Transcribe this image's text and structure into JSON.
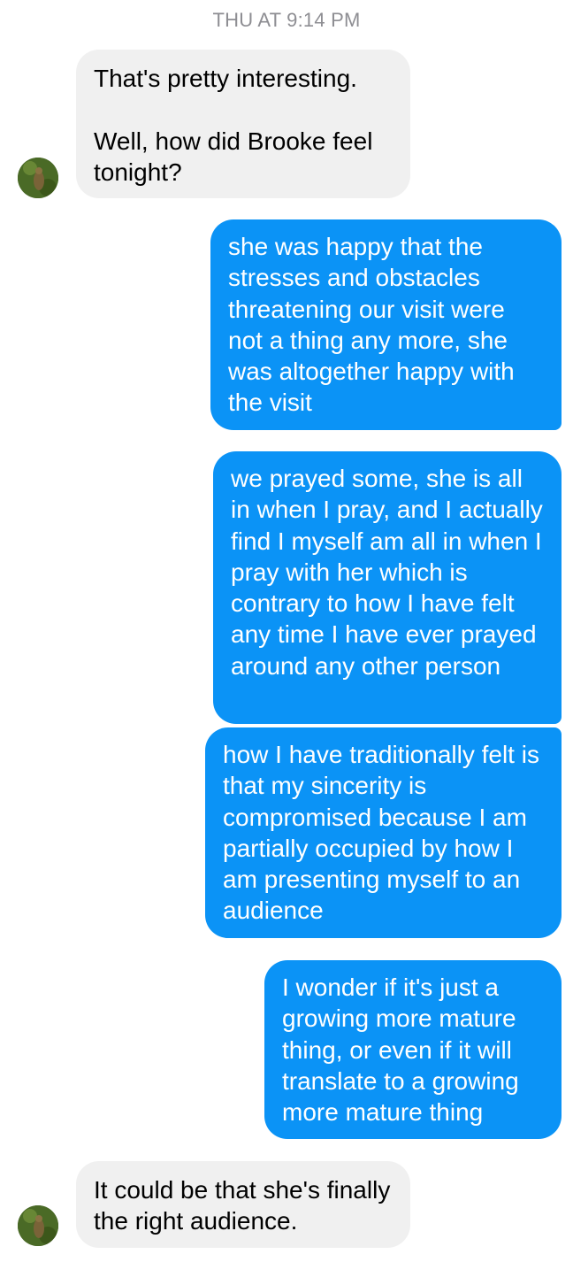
{
  "thread": {
    "timestamp": "THU AT 9:14 PM",
    "messages": [
      {
        "direction": "incoming",
        "text": "That's pretty interesting.\n\nWell, how did Brooke feel tonight?"
      },
      {
        "direction": "outgoing",
        "text": "she was happy that the stresses and obstacles threatening our visit were not a thing any more, she was altogether happy with the visit"
      },
      {
        "direction": "outgoing",
        "text": "we prayed some, she is all in when I pray, and I actually find I myself am all in when I pray with her which is contrary to how I have felt any time I have ever prayed around any other person"
      },
      {
        "direction": "outgoing",
        "text": "how I have traditionally felt is that my sincerity is compromised because I am partially occupied by how I am presenting myself to an audience"
      },
      {
        "direction": "outgoing",
        "text": "I wonder if it's just a growing more mature thing, or even if it will translate to a growing more mature thing"
      },
      {
        "direction": "incoming",
        "text": "It could be that she's finally the right audience."
      }
    ]
  },
  "colors": {
    "incoming_bubble": "#f0f0f0",
    "outgoing_bubble": "#0b93f6",
    "timestamp_text": "#8e8e93"
  },
  "icons": {
    "contact_avatar": "avatar-photo-icon"
  }
}
